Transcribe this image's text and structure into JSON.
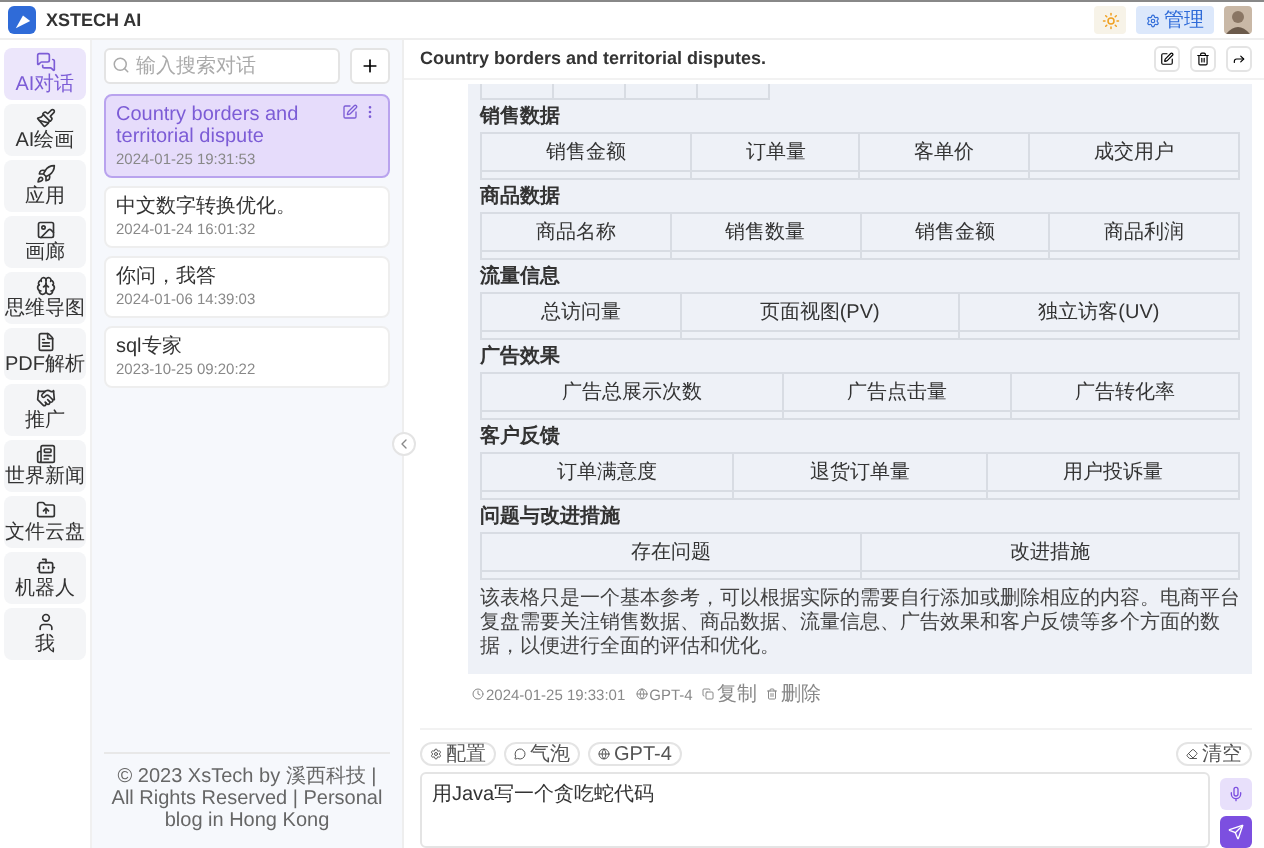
{
  "app": {
    "name": "XSTECH AI",
    "admin_button": "管理"
  },
  "nav": [
    {
      "label": "AI对话",
      "selected": true
    },
    {
      "label": "AI绘画",
      "selected": false
    },
    {
      "label": "应用",
      "selected": false
    },
    {
      "label": "画廊",
      "selected": false
    },
    {
      "label": "思维导图",
      "selected": false
    },
    {
      "label": "PDF解析",
      "selected": false
    },
    {
      "label": "推广",
      "selected": false
    },
    {
      "label": "世界新闻",
      "selected": false
    },
    {
      "label": "文件云盘",
      "selected": false
    },
    {
      "label": "机器人",
      "selected": false
    },
    {
      "label": "我",
      "selected": false
    }
  ],
  "search": {
    "placeholder": "输入搜索对话"
  },
  "chats": [
    {
      "title": "Country borders and territorial dispute",
      "time": "2024-01-25 19:31:53",
      "selected": true
    },
    {
      "title": "中文数字转换优化。",
      "time": "2024-01-24 16:01:32",
      "selected": false
    },
    {
      "title": "你问，我答",
      "time": "2024-01-06 14:39:03",
      "selected": false
    },
    {
      "title": "sql专家",
      "time": "2023-10-25 09:20:22",
      "selected": false
    }
  ],
  "footer": "© 2023 XsTech by 溪西科技 | All Rights Reserved | Personal blog in Hong Kong",
  "conversation": {
    "title": "Country borders and territorial disputes."
  },
  "message": {
    "sections": [
      {
        "title": "销售数据",
        "columns": [
          "销售金额",
          "订单量",
          "客单价",
          "成交用户"
        ]
      },
      {
        "title": "商品数据",
        "columns": [
          "商品名称",
          "销售数量",
          "销售金额",
          "商品利润"
        ]
      },
      {
        "title": "流量信息",
        "columns": [
          "总访问量",
          "页面视图(PV)",
          "独立访客(UV)"
        ]
      },
      {
        "title": "广告效果",
        "columns": [
          "广告总展示次数",
          "广告点击量",
          "广告转化率"
        ]
      },
      {
        "title": "客户反馈",
        "columns": [
          "订单满意度",
          "退货订单量",
          "用户投诉量"
        ]
      },
      {
        "title": "问题与改进措施",
        "columns": [
          "存在问题",
          "改进措施"
        ]
      }
    ],
    "summary": "该表格只是一个基本参考，可以根据实际的需要自行添加或删除相应的内容。电商平台复盘需要关注销售数据、商品数据、流量信息、广告效果和客户反馈等多个方面的数据，以便进行全面的评估和优化。",
    "time": "2024-01-25 19:33:01",
    "model": "GPT-4",
    "copy": "复制",
    "delete": "删除"
  },
  "toolbar": {
    "chips": [
      "配置",
      "气泡",
      "GPT-4"
    ],
    "clear": "清空"
  },
  "input": {
    "value": "用Java写一个贪吃蛇代码"
  }
}
